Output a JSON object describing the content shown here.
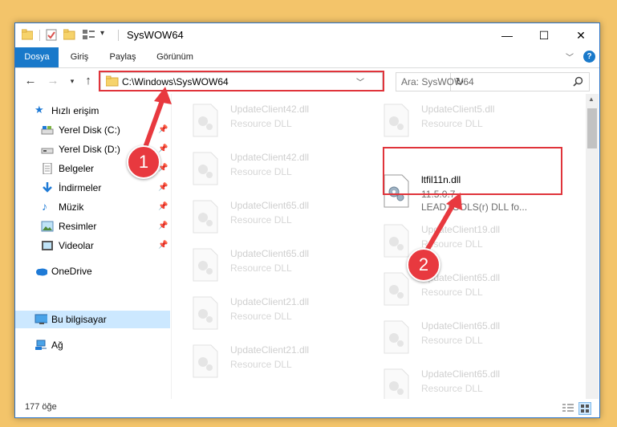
{
  "window": {
    "title": "SysWOW64",
    "controls": {
      "minimize": "—",
      "maximize": "☐",
      "close": "✕"
    }
  },
  "ribbon": {
    "tabs": [
      "Dosya",
      "Giriş",
      "Paylaş",
      "Görünüm"
    ]
  },
  "address": {
    "path": "C:\\Windows\\SysWOW64",
    "search_placeholder": "Ara: SysWOW64"
  },
  "sidebar": {
    "items": [
      {
        "label": "Hızlı erişim",
        "icon": "star-icon"
      },
      {
        "label": "Yerel Disk (C:)",
        "icon": "drive-icon"
      },
      {
        "label": "Yerel Disk (D:)",
        "icon": "drive-icon"
      },
      {
        "label": "Belgeler",
        "icon": "document-icon"
      },
      {
        "label": "İndirmeler",
        "icon": "download-icon"
      },
      {
        "label": "Müzik",
        "icon": "music-icon"
      },
      {
        "label": "Resimler",
        "icon": "pictures-icon"
      },
      {
        "label": "Videolar",
        "icon": "video-icon"
      },
      {
        "label": "OneDrive",
        "icon": "cloud-icon"
      },
      {
        "label": "Bu bilgisayar",
        "icon": "computer-icon"
      },
      {
        "label": "Ağ",
        "icon": "network-icon"
      }
    ]
  },
  "files": {
    "left": [
      {
        "name": "UpdateClient42.dll",
        "desc": "Resource DLL"
      },
      {
        "name": "UpdateClient42.dll",
        "desc": "Resource DLL"
      },
      {
        "name": "UpdateClient65.dll",
        "desc": "Resource DLL"
      },
      {
        "name": "UpdateClient65.dll",
        "desc": "Resource DLL"
      },
      {
        "name": "UpdateClient21.dll",
        "desc": "Resource DLL"
      },
      {
        "name": "UpdateClient21.dll",
        "desc": "Resource DLL"
      }
    ],
    "right": [
      {
        "name": "UpdateClient5.dll",
        "desc": "Resource DLL"
      },
      {
        "name": "ltfil11n.dll",
        "desc": "11.5.0.7",
        "desc2": "LEADTOOLS(r) DLL fo..."
      },
      {
        "name": "UpdateClient19.dll",
        "desc": "Resource DLL"
      },
      {
        "name": "UpdateClient65.dll",
        "desc": "Resource DLL"
      },
      {
        "name": "UpdateClient65.dll",
        "desc": "Resource DLL"
      },
      {
        "name": "UpdateClient65.dll",
        "desc": "Resource DLL"
      }
    ]
  },
  "status": {
    "count": "177 öğe"
  },
  "callouts": [
    "1",
    "2"
  ],
  "colors": {
    "accent": "#1979ca",
    "highlight": "#e0343b",
    "selected": "#cce8ff"
  }
}
